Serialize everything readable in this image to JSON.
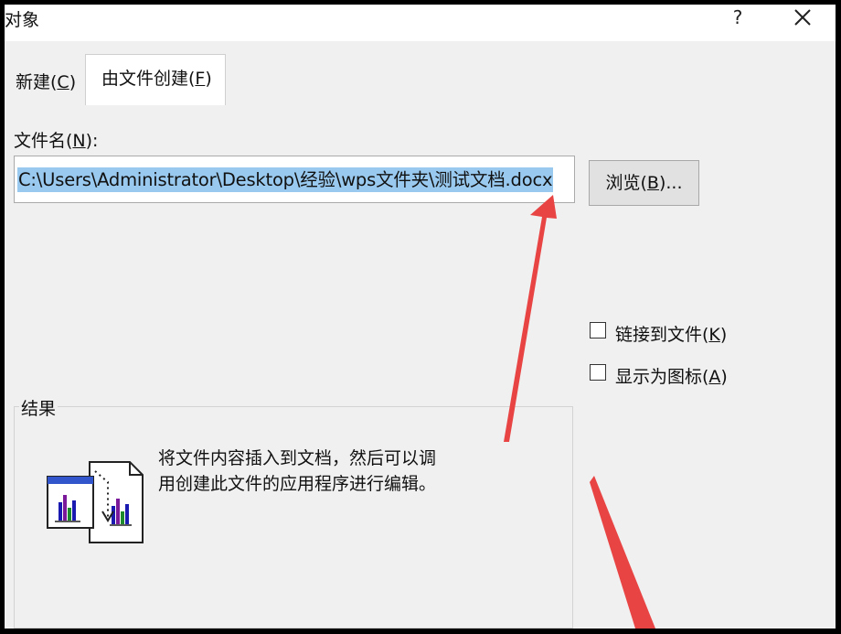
{
  "window": {
    "title": "对象",
    "help_label": "?"
  },
  "tabs": [
    {
      "label_pre": "新建(",
      "key": "C",
      "label_post": ")"
    },
    {
      "label_pre": "由文件创建(",
      "key": "F",
      "label_post": ")"
    }
  ],
  "filename": {
    "label_pre": "文件名(",
    "key": "N",
    "label_post": "):",
    "value": "C:\\Users\\Administrator\\Desktop\\经验\\wps文件夹\\测试文档.docx"
  },
  "browse_button": {
    "label_pre": "浏览(",
    "key": "B",
    "label_post": ")..."
  },
  "options": [
    {
      "label_pre": "链接到文件(",
      "key": "K",
      "label_post": ")",
      "checked": false
    },
    {
      "label_pre": "显示为图标(",
      "key": "A",
      "label_post": ")",
      "checked": false
    }
  ],
  "result": {
    "label": "结果",
    "description_line1": "将文件内容插入到文档，然后可以调",
    "description_line2": "用创建此文件的应用程序进行编辑。"
  },
  "colors": {
    "annotation_arrow": "#e94444",
    "selection": "#99c9ef",
    "dialog_bg": "#f0f0f0"
  },
  "icons": [
    "close-icon",
    "insert-file-icon",
    "red-arrow-annotation"
  ]
}
